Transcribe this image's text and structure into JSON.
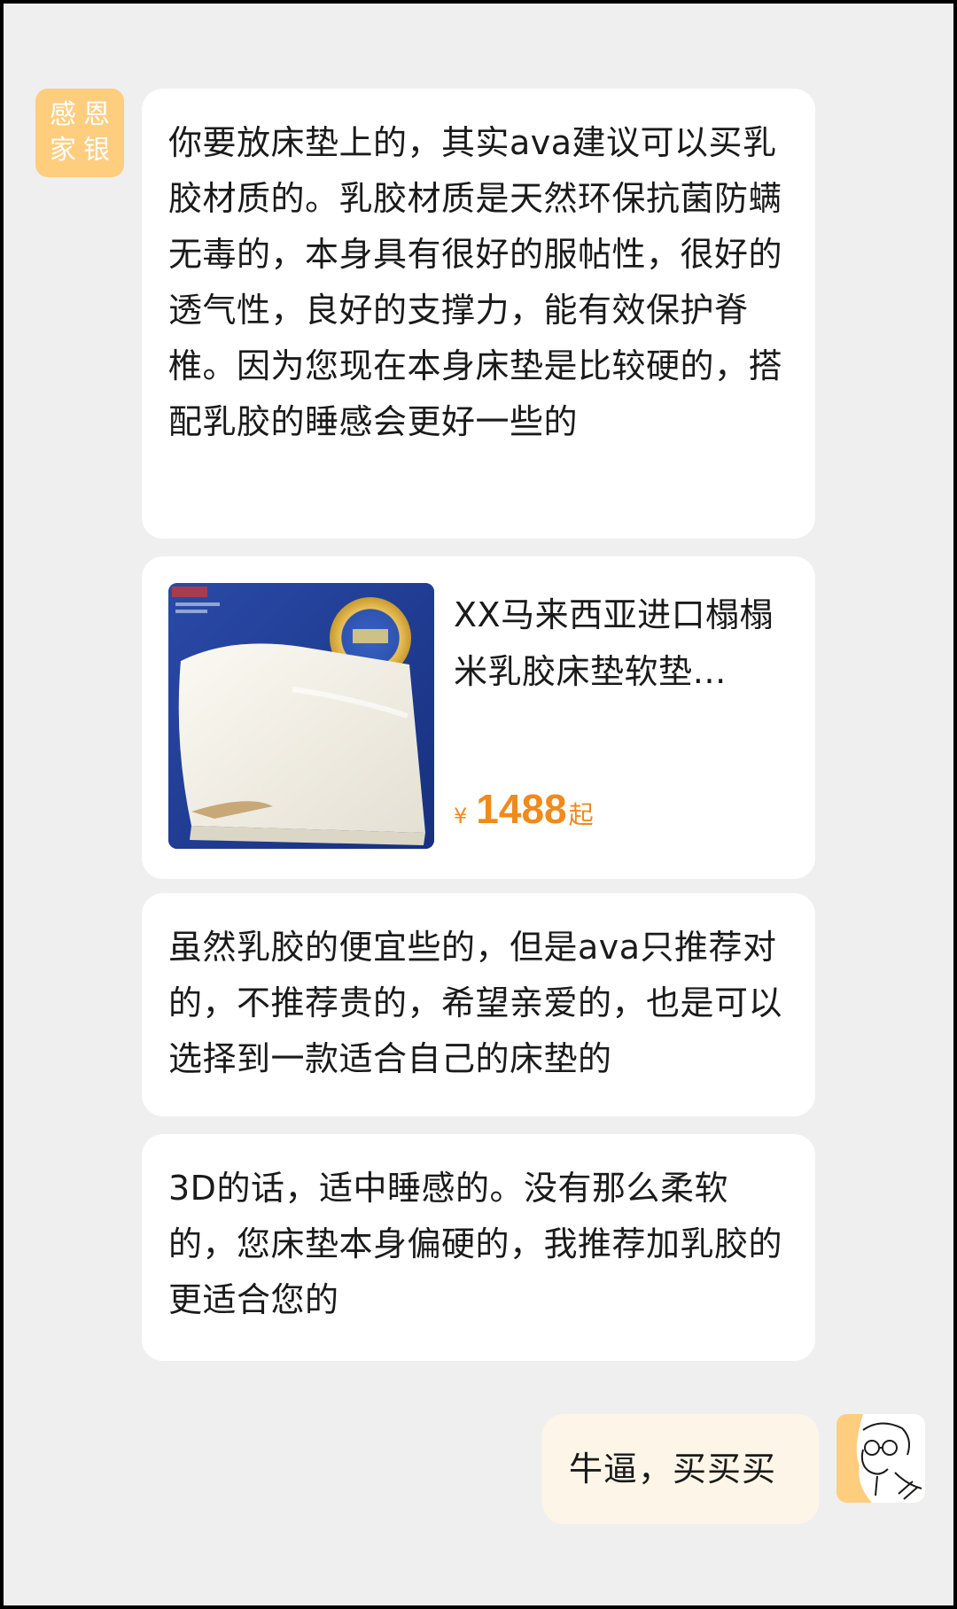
{
  "chat": {
    "agent_avatar": {
      "chars": [
        "感",
        "恩",
        "家",
        "银"
      ],
      "color": "#ffcd7e"
    },
    "messages": [
      {
        "text": "你要放床垫上的，其实ava建议可以买乳胶材质的。乳胶材质是天然环保抗菌防螨 无毒的，本身具有很好的服帖性，很好的透气性，良好的支撑力，能有效保护脊椎。因为您现在本身床垫是比较硬的，搭配乳胶的睡感会更好一些的"
      },
      {
        "product": {
          "title": "XX马来西亚进口榻榻米乳胶床垫软垫…",
          "price_currency": "¥",
          "price_value": "1488",
          "price_suffix": "起"
        }
      },
      {
        "text": "虽然乳胶的便宜些的，但是ava只推荐对的，不推荐贵的，希望亲爱的，也是可以选择到一款适合自己的床垫的"
      },
      {
        "text": "3D的话，适中睡感的。没有那么柔软的，您床垫本身偏硬的，我推荐加乳胶的更适合您的"
      }
    ],
    "user_message": {
      "text": "牛逼，买买买"
    }
  },
  "colors": {
    "background": "#efefef",
    "bubble": "#ffffff",
    "user_bubble": "#fdf6e8",
    "price": "#f08a1b",
    "avatar": "#ffcd7e"
  }
}
